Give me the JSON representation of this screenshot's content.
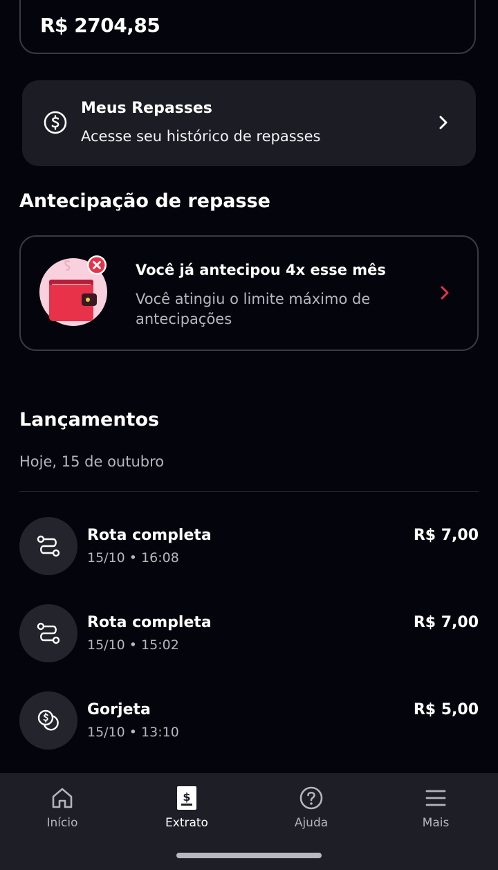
{
  "balance": {
    "value": "R$ 2704,85"
  },
  "repasses": {
    "title": "Meus Repasses",
    "subtitle": "Acesse seu histórico de repasses",
    "icon": "dollar-circle-icon"
  },
  "antecipacao": {
    "section_title": "Antecipação de repasse",
    "title": "Você já antecipou 4x esse mês",
    "subtitle": "Você atingiu o limite máximo de antecipações",
    "accent_color": "#e8324a"
  },
  "lancamentos": {
    "section_title": "Lançamentos",
    "date_label": "Hoje, 15 de outubro",
    "items": [
      {
        "title": "Rota completa",
        "time": "15/10 • 16:08",
        "amount": "R$ 7,00",
        "icon": "route-icon"
      },
      {
        "title": "Rota completa",
        "time": "15/10 • 15:02",
        "amount": "R$ 7,00",
        "icon": "route-icon"
      },
      {
        "title": "Gorjeta",
        "time": "15/10 • 13:10",
        "amount": "R$ 5,00",
        "icon": "coins-icon"
      }
    ]
  },
  "nav": {
    "items": [
      {
        "label": "Início",
        "icon": "home-icon"
      },
      {
        "label": "Extrato",
        "icon": "receipt-icon",
        "active": true
      },
      {
        "label": "Ajuda",
        "icon": "help-icon"
      },
      {
        "label": "Mais",
        "icon": "menu-icon"
      }
    ]
  }
}
